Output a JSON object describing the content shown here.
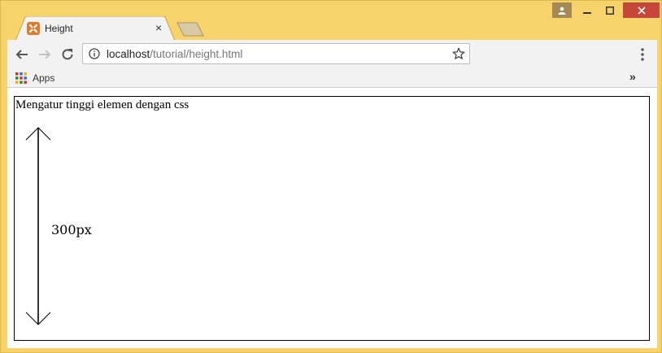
{
  "tab": {
    "title": "Height",
    "close_glyph": "×",
    "favicon": "xampp-icon"
  },
  "toolbar": {
    "url_host": "localhost",
    "url_path": "/tutorial/height.html"
  },
  "bookmarks": {
    "apps_label": "Apps",
    "overflow_glyph": "»"
  },
  "page": {
    "text": "Mengatur tinggi elemen dengan css",
    "height_label": "300px"
  },
  "colors": {
    "frame": "#f6d36b",
    "close_button": "#c7453b",
    "favicon": "#e07a2c"
  }
}
